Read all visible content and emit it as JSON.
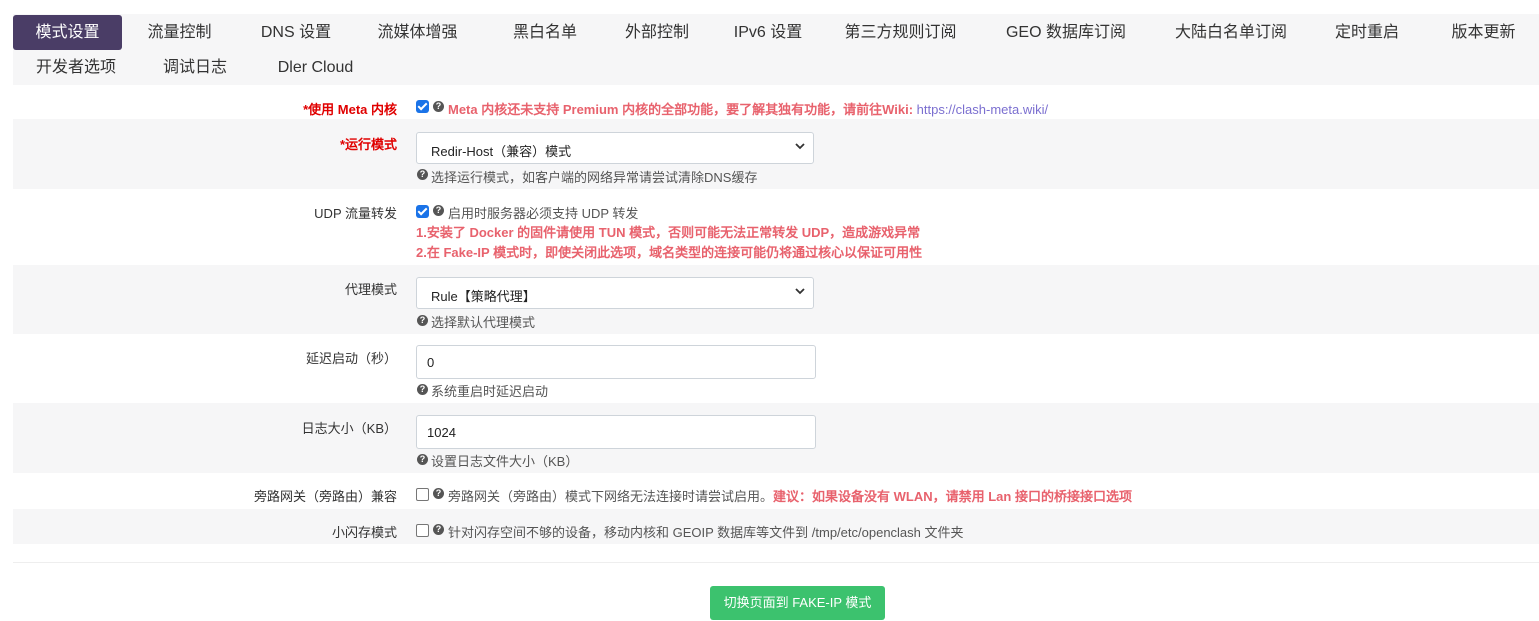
{
  "tabs": [
    {
      "label": "模式设置",
      "active": true
    },
    {
      "label": "流量控制"
    },
    {
      "label": "DNS 设置"
    },
    {
      "label": "流媒体增强"
    },
    {
      "label": "黑白名单"
    },
    {
      "label": "外部控制"
    },
    {
      "label": "IPv6 设置"
    },
    {
      "label": "第三方规则订阅"
    },
    {
      "label": "GEO 数据库订阅"
    },
    {
      "label": "大陆白名单订阅"
    },
    {
      "label": "定时重启"
    },
    {
      "label": "版本更新"
    },
    {
      "label": "开发者选项"
    },
    {
      "label": "调试日志"
    },
    {
      "label": "Dler Cloud"
    }
  ],
  "settings": {
    "meta_core": {
      "label": "*使用 Meta 内核",
      "checked": true,
      "help_prefix": "Meta 内核还未支持 Premium 内核的全部功能，要了解其独有功能，请前往Wiki: ",
      "help_link": "https://clash-meta.wiki/"
    },
    "run_mode": {
      "label": "*运行模式",
      "value": "Redir-Host（兼容）模式",
      "help": "选择运行模式，如客户端的网络异常请尝试清除DNS缓存"
    },
    "udp_forward": {
      "label": "UDP 流量转发",
      "checked": true,
      "help": "启用时服务器必须支持 UDP 转发",
      "warn1": "1.安装了 Docker 的固件请使用 TUN 模式，否则可能无法正常转发 UDP，造成游戏异常",
      "warn2": "2.在 Fake-IP 模式时，即使关闭此选项，域名类型的连接可能仍将通过核心以保证可用性"
    },
    "proxy_mode": {
      "label": "代理模式",
      "value": "Rule【策略代理】",
      "help": "选择默认代理模式"
    },
    "delay_start": {
      "label": "延迟启动（秒）",
      "value": "0",
      "help": "系统重启时延迟启动"
    },
    "log_size": {
      "label": "日志大小（KB）",
      "value": "1024",
      "help": "设置日志文件大小（KB）"
    },
    "bypass_gateway": {
      "label": "旁路网关（旁路由）兼容",
      "checked": false,
      "help": "旁路网关（旁路由）模式下网络无法连接时请尝试启用。",
      "warn": "建议：如果设备没有 WLAN，请禁用 Lan 接口的桥接接口选项"
    },
    "small_flash": {
      "label": "小闪存模式",
      "checked": false,
      "help": "针对闪存空间不够的设备，移动内核和 GEOIP 数据库等文件到 /tmp/etc/openclash 文件夹"
    }
  },
  "switch_button": {
    "label": "切换页面到 FAKE-IP 模式"
  },
  "colors": {
    "active_tab": "#4a3d66",
    "required": "#e00000",
    "warning": "#e8626d",
    "link": "#7b6fd0",
    "button": "#3cc26e"
  }
}
